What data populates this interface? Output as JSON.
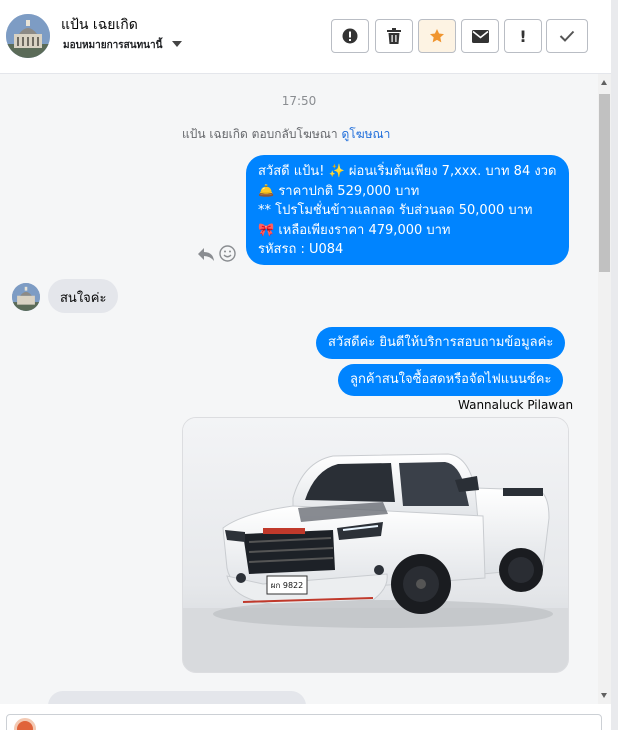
{
  "header": {
    "contact_name": "แป้น เฉยเกิด",
    "assignee_label": "มอบหมายการสนทนานี้",
    "actions": [
      {
        "name": "spam-button",
        "icon": "alert-circle-icon"
      },
      {
        "name": "delete-button",
        "icon": "trash-icon"
      },
      {
        "name": "star-button",
        "icon": "star-icon",
        "active": true,
        "color": "#f0952f"
      },
      {
        "name": "mark-unread-button",
        "icon": "envelope-icon"
      },
      {
        "name": "follow-up-button",
        "icon": "exclamation-icon"
      },
      {
        "name": "mark-done-button",
        "icon": "check-icon"
      }
    ]
  },
  "conversation": {
    "timestamp": "17:50",
    "reply_note": "แป้น เฉยเกิด ตอบกลับโฆษณา",
    "reply_link": "ดูโฆษณา",
    "ad_message": {
      "line1": "สวัสดี แป้น! ✨  ผ่อนเริ่มต้นเพียง 7,xxx. บาท 84 งวด",
      "line2": "🛎️ ราคาปกติ 529,000 บาท",
      "line3": "** โปรโมชั่นข้าวแลกลด รับส่วนลด 50,000 บาท",
      "line4": "🎀  เหลือเพียงราคา 479,000 บาท",
      "line5": " รหัสรถ : U084"
    },
    "incoming_message": "สนใจค่ะ",
    "outgoing_1": "สวัสดีค่ะ  ยินดีให้บริการสอบถามข้อมูลค่ะ",
    "outgoing_2": "ลูกค้าสนใจซื้อสดหรือจัดไฟแนนซ์คะ",
    "sender_name": "Wannaluck Pilawan",
    "photo": {
      "plate": "ผก 9822",
      "province": "ชลบุรี"
    }
  },
  "colors": {
    "outgoing_bubble": "#0084ff",
    "incoming_bubble": "#e4e6eb",
    "link": "#216fdb",
    "star_active": "#f0952f"
  }
}
